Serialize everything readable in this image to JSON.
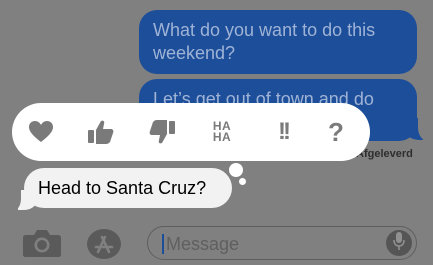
{
  "messages": {
    "sent_1": "What do you want to do this weekend?",
    "sent_2": "Let’s get out of town and do something fun!",
    "received_1": "Head to Santa Cruz?"
  },
  "status": {
    "delivered": "Afgeleverd"
  },
  "tapback": {
    "haha_top": "HA",
    "haha_bottom": "HA",
    "emphasis": "!!",
    "question": "?"
  },
  "composer": {
    "placeholder": "Message"
  },
  "icons": [
    "heart-icon",
    "thumbs-up-icon",
    "thumbs-down-icon",
    "haha-icon",
    "exclamation-icon",
    "question-icon",
    "camera-icon",
    "app-store-icon",
    "microphone-icon"
  ],
  "colors": {
    "sent_bubble": "#1d4e9a",
    "received_bubble": "#f2f2f2",
    "background": "#808080",
    "tapback_icon": "#7a7a7a"
  }
}
